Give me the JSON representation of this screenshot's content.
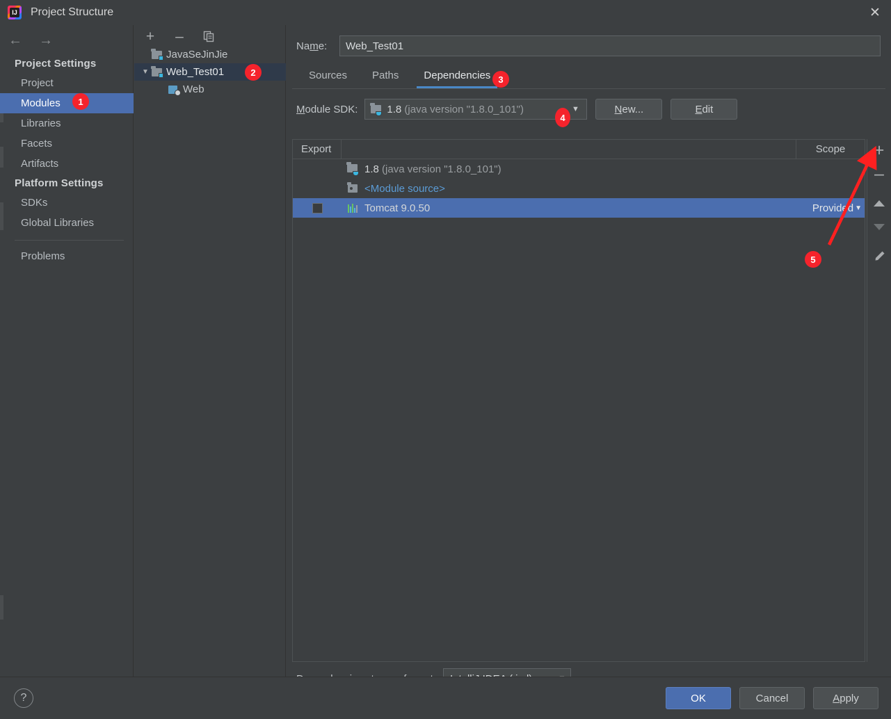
{
  "window": {
    "title": "Project Structure",
    "app_icon": "intellij-idea-icon",
    "close_icon": "✕"
  },
  "sidebar": {
    "nav": {
      "back_icon": "←",
      "forward_icon": "→"
    },
    "groups": [
      {
        "title": "Project Settings",
        "items": [
          {
            "label": "Project",
            "selected": false
          },
          {
            "label": "Modules",
            "selected": true,
            "badge": "1"
          },
          {
            "label": "Libraries",
            "selected": false
          },
          {
            "label": "Facets",
            "selected": false
          },
          {
            "label": "Artifacts",
            "selected": false
          }
        ]
      },
      {
        "title": "Platform Settings",
        "items": [
          {
            "label": "SDKs",
            "selected": false
          },
          {
            "label": "Global Libraries",
            "selected": false
          }
        ]
      }
    ],
    "extra_items": [
      {
        "label": "Problems",
        "selected": false
      }
    ]
  },
  "tree": {
    "toolbar": [
      {
        "name": "add-module-button",
        "glyph": "+"
      },
      {
        "name": "remove-module-button",
        "glyph": "–"
      },
      {
        "name": "copy-module-button",
        "glyph": "copy"
      }
    ],
    "rows": [
      {
        "label": "JavaSeJinJie",
        "icon": "module-icon",
        "twisty": "",
        "indent": 1,
        "selected": false
      },
      {
        "label": "Web_Test01",
        "icon": "module-icon",
        "twisty": "▼",
        "indent": 0,
        "selected": true,
        "badge": "2"
      },
      {
        "label": "Web",
        "icon": "web-facet-icon",
        "twisty": "",
        "indent": 2,
        "selected": false
      }
    ]
  },
  "main": {
    "name_label": "Name:",
    "name_value": "Web_Test01",
    "tabs": [
      {
        "label": "Sources",
        "active": false
      },
      {
        "label": "Paths",
        "active": false
      },
      {
        "label": "Dependencies",
        "active": true,
        "badge": "3"
      }
    ],
    "sdk": {
      "label": "Module SDK:",
      "value_bold": "1.8",
      "value_dim": "(java version \"1.8.0_101\")",
      "badge": "4",
      "new_button": "New...",
      "edit_button": "Edit"
    },
    "table": {
      "columns": {
        "export": "Export",
        "name": "",
        "scope": "Scope"
      },
      "rows": [
        {
          "export_checkbox": null,
          "icon": "jdk-icon",
          "name_bold": "1.8",
          "name_dim": "(java version \"1.8.0_101\")",
          "scope": "",
          "selected": false,
          "style": "jdk"
        },
        {
          "export_checkbox": null,
          "icon": "module-source-icon",
          "name_bold": "<Module source>",
          "name_dim": "",
          "scope": "",
          "selected": false,
          "style": "modsrc"
        },
        {
          "export_checkbox": false,
          "icon": "library-bars-icon",
          "name_bold": "Tomcat 9.0.50",
          "name_dim": "",
          "scope": "Provided",
          "selected": true,
          "style": "lib"
        }
      ]
    },
    "side_toolbar": [
      {
        "name": "add-dependency-button",
        "glyph": "+",
        "badge": "5"
      },
      {
        "name": "remove-dependency-button",
        "glyph": "–"
      },
      {
        "name": "move-up-button",
        "glyph": "▲"
      },
      {
        "name": "move-down-button",
        "glyph": "▼"
      },
      {
        "name": "edit-dependency-button",
        "glyph": "pencil"
      }
    ],
    "storage": {
      "label": "Dependencies storage format:",
      "value": "IntelliJ IDEA (.iml)"
    }
  },
  "bottom": {
    "help_label": "?",
    "ok": "OK",
    "cancel": "Cancel",
    "apply": "Apply"
  },
  "annotations": {
    "badge_color": "#f5232c",
    "arrow_color": "#fe2020",
    "badges": [
      {
        "id": "1",
        "target": "sidebar-item-modules"
      },
      {
        "id": "2",
        "target": "tree-row-web-test01"
      },
      {
        "id": "3",
        "target": "tab-dependencies"
      },
      {
        "id": "4",
        "target": "module-sdk-combo"
      },
      {
        "id": "5",
        "target": "add-dependency-button"
      }
    ]
  },
  "colors": {
    "dialog_bg": "#3c3f41",
    "selection_blue": "#4b6eaf",
    "tree_selection": "#2f3a4a",
    "tab_underline": "#4a88c7",
    "link_blue": "#5b9bd5",
    "text": "#bbbbbb"
  }
}
